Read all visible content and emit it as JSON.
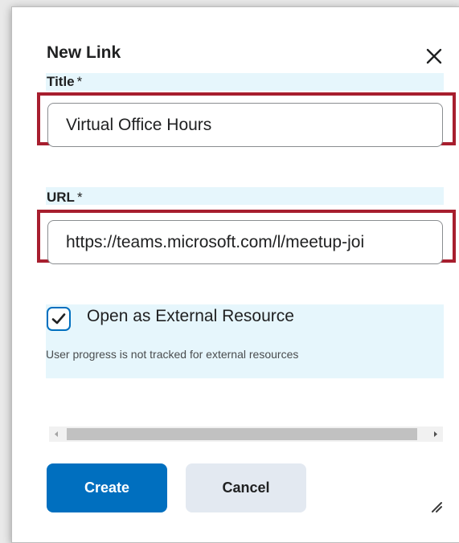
{
  "dialog": {
    "title": "New Link",
    "close_icon": "close-icon"
  },
  "title_field": {
    "label": "Title",
    "required_mark": "*",
    "value": "Virtual Office Hours"
  },
  "url_field": {
    "label": "URL",
    "required_mark": "*",
    "value": "https://teams.microsoft.com/l/meetup-joi"
  },
  "external_resource": {
    "checked": true,
    "label": "Open as External Resource",
    "helper": "User progress is not tracked for external resources"
  },
  "buttons": {
    "create": "Create",
    "cancel": "Cancel"
  },
  "colors": {
    "primary": "#006fbf",
    "highlight": "#a71e2e",
    "label_background": "#e6f6fc"
  }
}
